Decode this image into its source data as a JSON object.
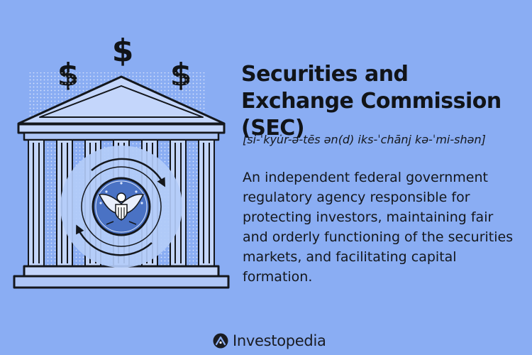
{
  "title": "Securities and Exchange Commission (SEC)",
  "pronunciation": "[si-ˈkyu̇r-ə-tēs ən(d) iks-ˈchānj kə-ˈmi-shən]",
  "definition": "An independent federal government regulatory agency responsible for protecting investors, maintaining fair and orderly functioning of the securities markets, and facilitating capital formation.",
  "brand": {
    "name": "Investopedia"
  },
  "illustration": {
    "dollar_sign": "$",
    "icons": [
      "bank-building-icon",
      "dollar-sign-icon",
      "refresh-arrows-icon",
      "eagle-seal-icon"
    ]
  },
  "colors": {
    "background": "#8aadf3",
    "ink": "#14171c",
    "building_light": "#c4d6fb",
    "seal": "#4a72c4",
    "halo": "#b3ccf8",
    "brand_blue": "#2563eb"
  }
}
